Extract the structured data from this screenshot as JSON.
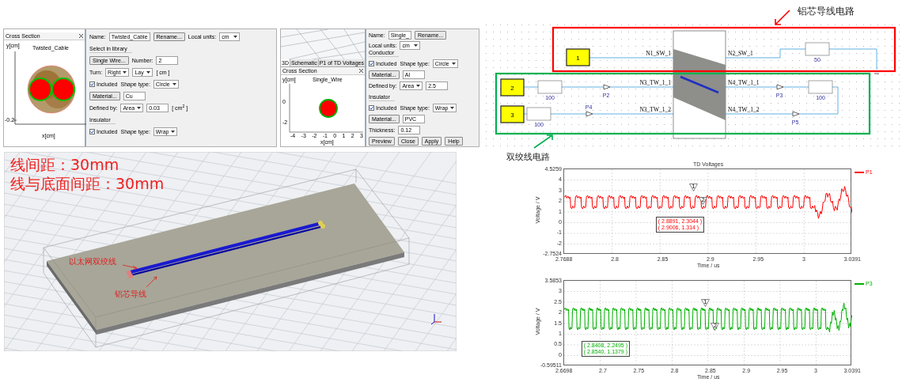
{
  "cable_panel": {
    "cross_section": {
      "title": "Cross Section",
      "plot_title": "Twisted_Cable",
      "y_label": "y[cm]",
      "y_tick": "-0.2",
      "x_label": "x[cm]"
    },
    "dialog": {
      "rows": [
        {
          "items": [
            {
              "kind": "label",
              "text": "Name:"
            },
            {
              "kind": "field",
              "text": "Twisted_Cable"
            },
            {
              "kind": "button",
              "text": "Rename..."
            },
            {
              "kind": "label",
              "text": "Local units:"
            },
            {
              "kind": "select",
              "text": "cm"
            }
          ]
        },
        {
          "items": [
            {
              "kind": "section",
              "text": "Select in library"
            }
          ]
        },
        {
          "items": [
            {
              "kind": "button",
              "text": "Single Wire..."
            },
            {
              "kind": "label",
              "text": "Number:"
            },
            {
              "kind": "field",
              "text": "2"
            }
          ]
        },
        {
          "items": [
            {
              "kind": "label",
              "text": "Turn:"
            },
            {
              "kind": "select",
              "text": "Right"
            },
            {
              "kind": "select",
              "text": "Lay"
            },
            {
              "kind": "label",
              "text": "[ cm ]"
            }
          ]
        },
        {
          "items": [
            {
              "kind": "checkbox",
              "text": "Included",
              "checked": true
            },
            {
              "kind": "label",
              "text": "Shape type:"
            },
            {
              "kind": "select",
              "text": "Circle"
            }
          ]
        },
        {
          "items": [
            {
              "kind": "button",
              "text": "Material..."
            },
            {
              "kind": "field",
              "text": "Cu"
            }
          ]
        },
        {
          "items": [
            {
              "kind": "label",
              "text": "Defined by:"
            },
            {
              "kind": "select",
              "text": "Area"
            },
            {
              "kind": "field",
              "text": "0.03"
            },
            {
              "kind": "label",
              "text": "[ cm$^{2}$ ]"
            }
          ]
        },
        {
          "items": [
            {
              "kind": "section",
              "text": "Insulator"
            }
          ]
        },
        {
          "items": [
            {
              "kind": "checkbox",
              "text": "Included",
              "checked": true
            },
            {
              "kind": "label",
              "text": "Shape type:"
            },
            {
              "kind": "select",
              "text": "Wrap"
            }
          ]
        }
      ]
    }
  },
  "wire_panel": {
    "tabs": [
      {
        "label": "3D",
        "selected": true
      },
      {
        "label": "Schematic",
        "selected": false
      },
      {
        "label": "P1 of TD Voltages",
        "selected": false
      }
    ],
    "cross_section": {
      "title": "Cross Section",
      "plot_title": "Single_Wire",
      "y_label": "y[cm]",
      "y_ticks": [
        "0",
        "-2"
      ],
      "x_ticks": [
        "-4",
        "-3",
        "-2",
        "-1",
        "0",
        "1",
        "2",
        "3"
      ],
      "x_label": "x[cm]"
    },
    "dialog": {
      "rows": [
        {
          "items": [
            {
              "kind": "label",
              "text": "Name:"
            },
            {
              "kind": "field",
              "text": "Single_"
            },
            {
              "kind": "button",
              "text": "Rename..."
            },
            {
              "kind": "label",
              "text": "Local units:"
            },
            {
              "kind": "select",
              "text": "cm"
            }
          ]
        },
        {
          "items": [
            {
              "kind": "section",
              "text": "Conductor"
            }
          ]
        },
        {
          "items": [
            {
              "kind": "checkbox",
              "text": "Included",
              "checked": true
            },
            {
              "kind": "label",
              "text": "Shape type:"
            },
            {
              "kind": "select",
              "text": "Circle"
            }
          ]
        },
        {
          "items": [
            {
              "kind": "button",
              "text": "Material..."
            },
            {
              "kind": "field",
              "text": "Al"
            }
          ]
        },
        {
          "items": [
            {
              "kind": "label",
              "text": "Defined by:"
            },
            {
              "kind": "select",
              "text": "Area"
            },
            {
              "kind": "field",
              "text": "2.5"
            }
          ]
        },
        {
          "items": [
            {
              "kind": "section",
              "text": "Insulator"
            }
          ]
        },
        {
          "items": [
            {
              "kind": "checkbox",
              "text": "Included",
              "checked": true
            },
            {
              "kind": "label",
              "text": "Shape type:"
            },
            {
              "kind": "select",
              "text": "Wrap"
            }
          ]
        },
        {
          "items": [
            {
              "kind": "button",
              "text": "Material..."
            },
            {
              "kind": "field",
              "text": "PVC"
            }
          ]
        },
        {
          "items": [
            {
              "kind": "label",
              "text": "Thickness:"
            },
            {
              "kind": "field",
              "text": "0.12"
            }
          ]
        },
        {
          "items": [
            {
              "kind": "button",
              "text": "Preview"
            },
            {
              "kind": "button",
              "text": "Close"
            },
            {
              "kind": "button",
              "text": "Apply"
            },
            {
              "kind": "button",
              "text": "Help"
            }
          ]
        }
      ]
    }
  },
  "model_view": {
    "captions": [
      "线间距：30mm",
      "线与底面间距：30mm"
    ],
    "callouts": [
      "以太网双绞线",
      "铝芯导线"
    ]
  },
  "schematic": {
    "callouts": [
      "铝芯导线电路",
      "双绞线电路"
    ],
    "ports": [
      "1",
      "2",
      "3"
    ],
    "nets": [
      "N1_SW_1",
      "N2_SW_1",
      "N3_TW_1_1",
      "N4_TW_1_1",
      "N3_TW_1_2",
      "N4_TW_1_2"
    ],
    "resistors": [
      "50",
      "100",
      "100",
      "100"
    ],
    "probes": [
      "P2",
      "P4",
      "P3",
      "P5"
    ]
  },
  "charts": [
    {
      "title": "TD Voltages",
      "y_label": "Voltage / V",
      "x_label": "Time / us",
      "legend": "P1",
      "color": "#ff0000",
      "y_ticks": [
        "4.5259",
        "4",
        "3",
        "2",
        "1",
        "0",
        "-1",
        "-2",
        "-2.7524"
      ],
      "x_ticks": [
        "2.7688",
        "2.8",
        "2.85",
        "2.9",
        "2.95",
        "3",
        "3.0391"
      ],
      "markers": [
        "1",
        "2"
      ],
      "readouts": [
        "( 2.8891, 2.3044 )",
        "( 2.9006, 1.314 )"
      ]
    },
    {
      "y_label": "Voltage / V",
      "x_label": "Time / us",
      "legend": "P3",
      "color": "#00b000",
      "y_ticks": [
        "3.5853",
        "3",
        "2.5",
        "2",
        "1.5",
        "1",
        "0.5",
        "0",
        "-0.59511"
      ],
      "x_ticks": [
        "2.6698",
        "2.7",
        "2.75",
        "2.8",
        "2.85",
        "2.9",
        "2.95",
        "3",
        "3.0391"
      ],
      "markers": [
        "1",
        "2"
      ],
      "readouts": [
        "( 2.8408, 2.2495 )",
        "( 2.8540, 1.1379 )"
      ]
    }
  ]
}
